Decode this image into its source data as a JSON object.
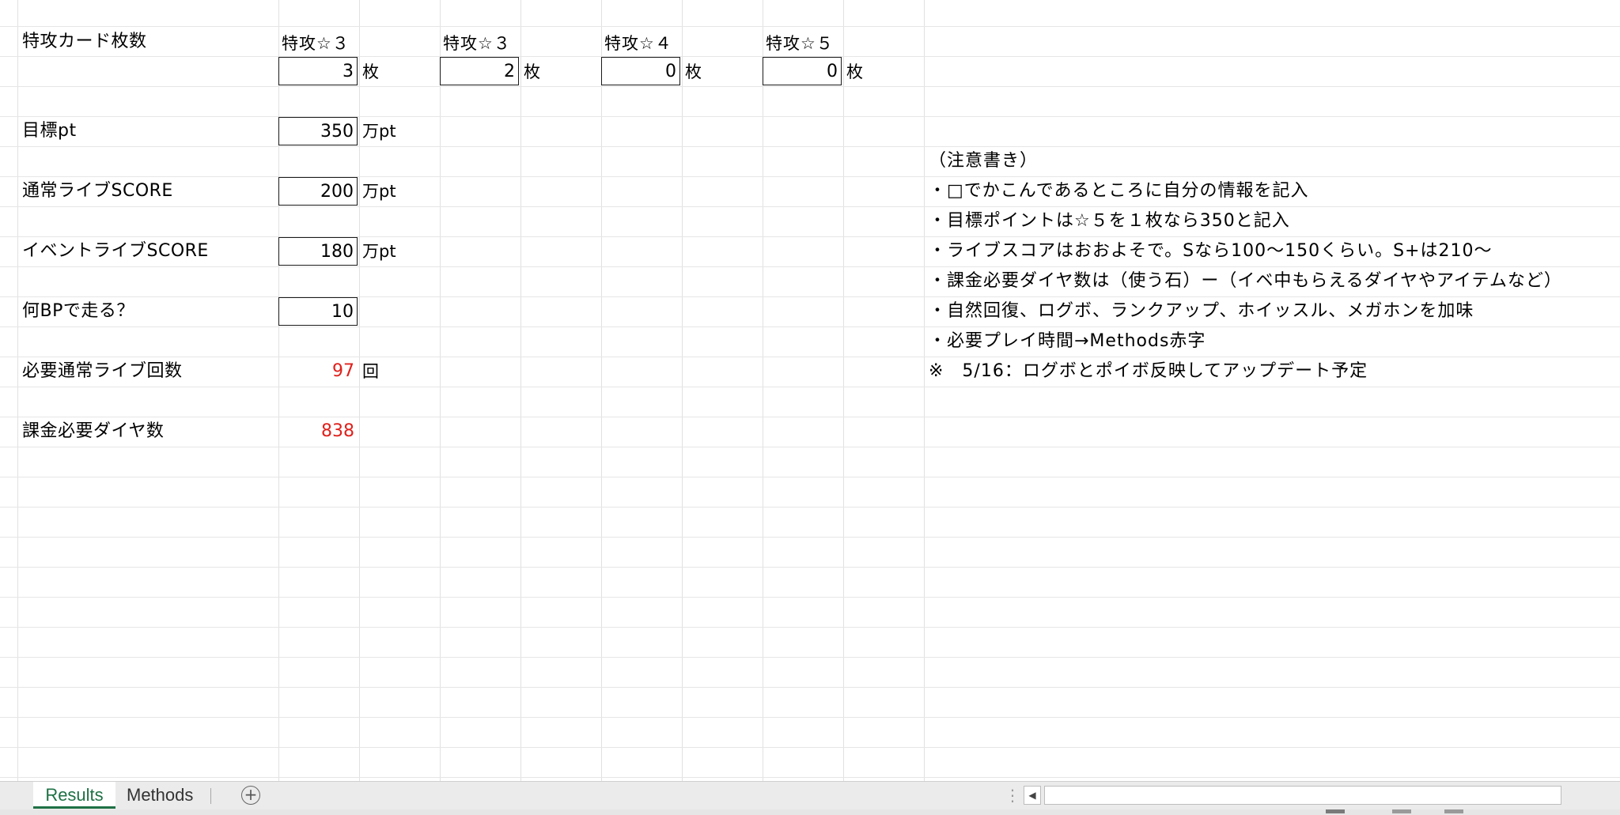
{
  "header": {
    "label": "特攻カード枚数",
    "cards": [
      {
        "title": "特攻☆３",
        "value": "3",
        "unit": "枚"
      },
      {
        "title": "特攻☆３",
        "value": "2",
        "unit": "枚"
      },
      {
        "title": "特攻☆４",
        "value": "0",
        "unit": "枚"
      },
      {
        "title": "特攻☆５",
        "value": "0",
        "unit": "枚"
      }
    ]
  },
  "inputs": {
    "target": {
      "label": "目標pt",
      "value": "350",
      "unit": "万pt"
    },
    "normal_score": {
      "label": "通常ライブSCORE",
      "value": "200",
      "unit": "万pt"
    },
    "event_score": {
      "label": "イベントライブSCORE",
      "value": "180",
      "unit": "万pt"
    },
    "bp": {
      "label": "何BPで走る？",
      "value": "10"
    }
  },
  "results": {
    "normal_count": {
      "label": "必要通常ライブ回数",
      "value": "97",
      "unit": "回"
    },
    "diamonds": {
      "label": "課金必要ダイヤ数",
      "value": "838"
    }
  },
  "notes": [
    "（注意書き）",
    "・□でかこんであるところに自分の情報を記入",
    "・目標ポイントは☆５を１枚なら350と記入",
    "・ライブスコアはおおよそで。Sなら100〜150くらい。S+は210〜",
    "・課金必要ダイヤ数は（使う石）ー（イベ中もらえるダイヤやアイテムなど）",
    "・自然回復、ログボ、ランクアップ、ホイッスル、メガホンを加味",
    "・必要プレイ時間→Methods赤字",
    "※　5/16：ログボとポイボ反映してアップデート予定"
  ],
  "sheets": {
    "tabs": [
      "Results",
      "Methods"
    ],
    "active": "Results"
  },
  "colors": {
    "result_text": "#e0201b",
    "active_tab": "#1e7145"
  }
}
